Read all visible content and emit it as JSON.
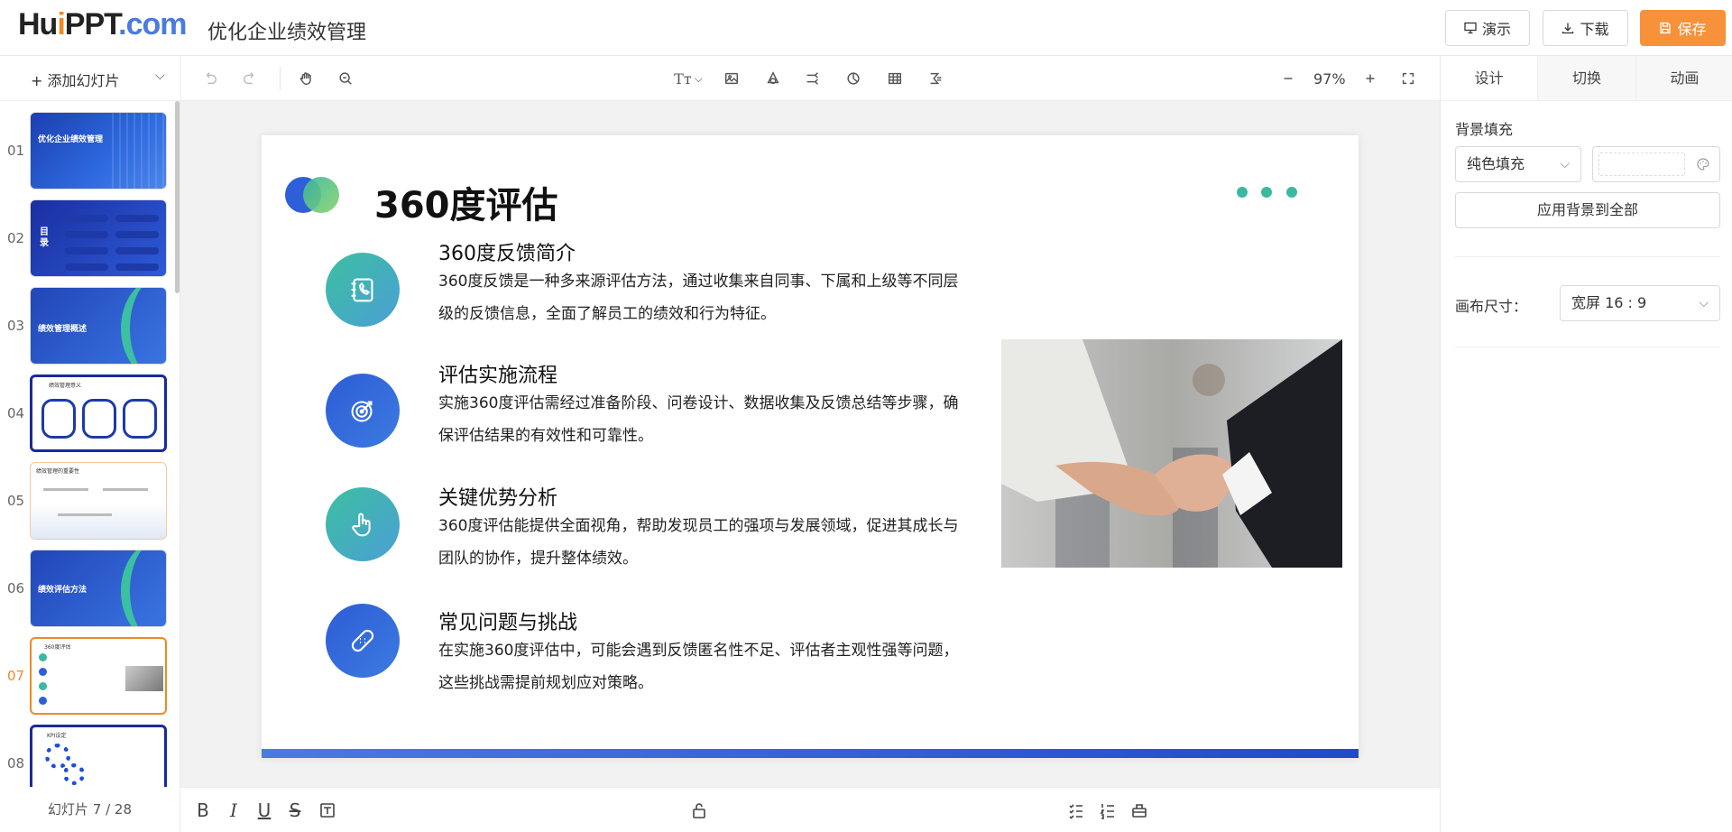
{
  "header": {
    "logo_a": "Hu",
    "logo_b": "i",
    "logo_c": "PPT",
    "logo_d": ".com",
    "doc_title": "优化企业绩效管理",
    "present_label": "演示",
    "download_label": "下载",
    "save_label": "保存"
  },
  "toolbar": {
    "add_slide_label": "+ 添加幻灯片",
    "zoom_value": "97%"
  },
  "sidebar": {
    "slide_count": "幻灯片 7 / 28",
    "thumbnails": [
      {
        "num": "01",
        "title": "优化企业绩效管理"
      },
      {
        "num": "02",
        "title": "目录"
      },
      {
        "num": "03",
        "title": "绩效管理概述"
      },
      {
        "num": "04",
        "title": "绩效管理意义"
      },
      {
        "num": "05",
        "title": "绩效管理的重要性"
      },
      {
        "num": "06",
        "title": "绩效评估方法"
      },
      {
        "num": "07",
        "title": "360度评估"
      },
      {
        "num": "08",
        "title": "KPI设定"
      }
    ]
  },
  "slide": {
    "title": "360度评估",
    "items": [
      {
        "title": "360度反馈简介",
        "text": "360度反馈是一种多来源评估方法，通过收集来自同事、下属和上级等不同层级的反馈信息，全面了解员工的绩效和行为特征。",
        "icon": "phone-book-icon"
      },
      {
        "title": "评估实施流程",
        "text": "实施360度评估需经过准备阶段、问卷设计、数据收集及反馈总结等步骤，确保评估结果的有效性和可靠性。",
        "icon": "target-icon"
      },
      {
        "title": "关键优势分析",
        "text": "360度评估能提供全面视角，帮助发现员工的强项与发展领域，促进其成长与团队的协作，提升整体绩效。",
        "icon": "hand-pointer-icon"
      },
      {
        "title": "常见问题与挑战",
        "text": "在实施360度评估中，可能会遇到反馈匿名性不足、评估者主观性强等问题，这些挑战需提前规划应对策略。",
        "icon": "bandage-icon"
      }
    ]
  },
  "right_panel": {
    "tabs": [
      "设计",
      "切换",
      "动画"
    ],
    "bg_fill_label": "背景填充",
    "bg_fill_value": "纯色填充",
    "apply_all_label": "应用背景到全部",
    "canvas_size_label": "画布尺寸：",
    "canvas_size_value": "宽屏 16 : 9"
  },
  "colors": {
    "accent": "#f7913a",
    "slide_blue": "#2f5fd8",
    "slide_teal": "#3bb8a0"
  }
}
